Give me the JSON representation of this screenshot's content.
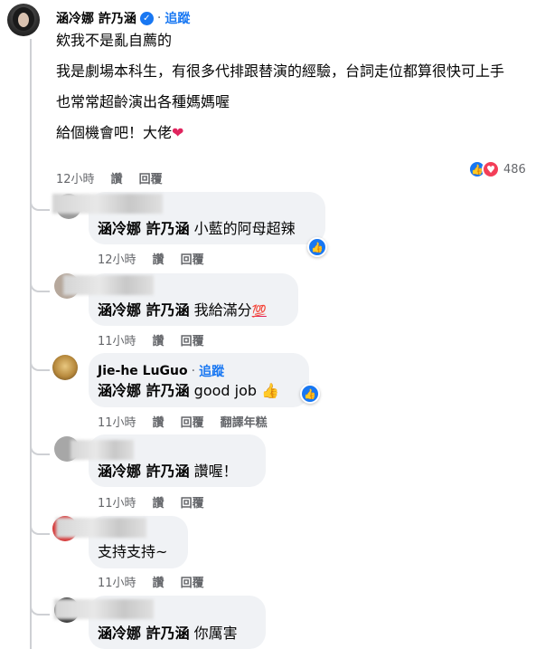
{
  "main_comment": {
    "author": "涵冷娜 許乃涵",
    "follow_label": "追蹤",
    "lines": [
      "欸我不是亂自薦的",
      "我是劇場本科生，有很多代排跟替演的經驗，台詞走位都算很快可上手",
      "也常常超齡演出各種媽媽喔",
      "給個機會吧！大佬"
    ],
    "time": "12小時",
    "like_label": "讚",
    "reply_label": "回覆",
    "reaction_count": "486"
  },
  "replies": [
    {
      "mention": "涵冷娜 許乃涵",
      "text": "小藍的阿母超辣",
      "time": "12小時",
      "like_label": "讚",
      "reply_label": "回覆"
    },
    {
      "mention": "涵冷娜 許乃涵",
      "text": "我給滿分",
      "emoji": "💯",
      "time": "11小時",
      "like_label": "讚",
      "reply_label": "回覆"
    },
    {
      "author": "Jie-he LuGuo",
      "follow_label": "追蹤",
      "mention": "涵冷娜 許乃涵",
      "text": "good job",
      "emoji": "👍",
      "time": "11小時",
      "like_label": "讚",
      "reply_label": "回覆",
      "translate_label": "翻譯年糕"
    },
    {
      "mention": "涵冷娜 許乃涵",
      "text": "讚喔！",
      "time": "11小時",
      "like_label": "讚",
      "reply_label": "回覆"
    },
    {
      "text": "支持支持~",
      "time": "11小時",
      "like_label": "讚",
      "reply_label": "回覆"
    },
    {
      "mention": "涵冷娜 許乃涵",
      "text": "你厲害"
    }
  ],
  "colors": {
    "link": "#1877f2",
    "bubble": "#f0f2f5",
    "meta": "#65676b",
    "like": "#1877f2",
    "love": "#f33e58"
  },
  "icons": {
    "verified": "verified-badge-icon",
    "like": "like-icon",
    "love": "love-icon"
  }
}
